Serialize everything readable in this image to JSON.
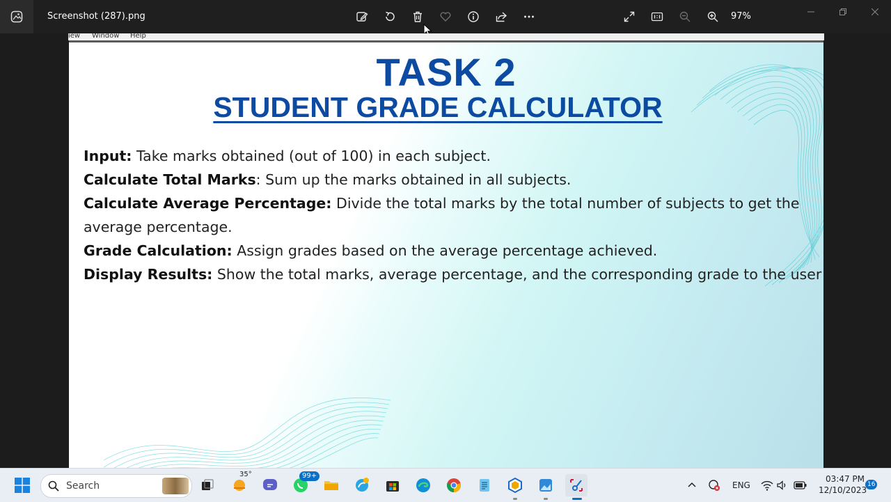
{
  "window": {
    "file_title": "Screenshot (287).png",
    "zoom_label": "97%"
  },
  "toolbar": {
    "icons": [
      "edit-image-icon",
      "rotate-icon",
      "delete-icon",
      "favorite-icon",
      "info-icon",
      "share-icon",
      "more-icon",
      "fullscreen-icon",
      "actual-size-icon",
      "zoom-out-icon",
      "zoom-in-icon"
    ]
  },
  "behind_menu": [
    "iew",
    "Window",
    "Help"
  ],
  "slide": {
    "title": "TASK 2",
    "subtitle": "STUDENT GRADE CALCULATOR",
    "points": [
      {
        "label": "Input:",
        "text": " Take marks obtained (out of 100) in each subject."
      },
      {
        "label": "Calculate Total Marks",
        "text": ": Sum up the marks obtained in all subjects."
      },
      {
        "label": "Calculate Average Percentage:",
        "text": " Divide the total marks by the total number of subjects to get the"
      },
      {
        "label": "",
        "text": "average percentage."
      },
      {
        "label": "Grade Calculation:",
        "text": " Assign grades based on the average percentage achieved."
      },
      {
        "label": "Display Results:",
        "text": " Show the total marks, average percentage, and the corresponding grade to the user"
      }
    ],
    "colors": {
      "title": "#0d4aa1",
      "wave": "#5fd0d8"
    }
  },
  "taskbar": {
    "search_placeholder": "Search",
    "weather_temp": "35°",
    "whatsapp_badge": "99+",
    "language": "ENG",
    "time": "03:47 PM",
    "date": "12/10/2023",
    "notification_count": "16"
  }
}
